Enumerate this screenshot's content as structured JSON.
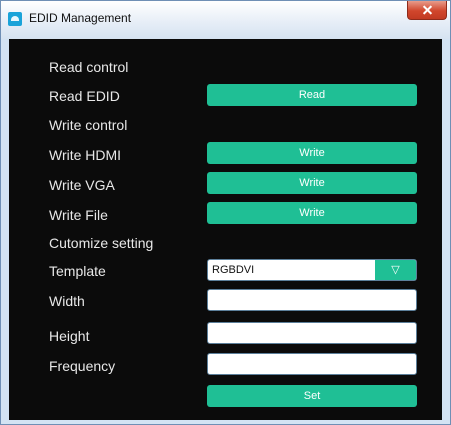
{
  "window": {
    "title": "EDID Management"
  },
  "read": {
    "section_label": "Read control",
    "edid_label": "Read EDID",
    "button_label": "Read"
  },
  "write": {
    "section_label": "Write control",
    "hdmi_label": "Write HDMI",
    "vga_label": "Write VGA",
    "file_label": "Write File",
    "button_label": "Write"
  },
  "custom": {
    "section_label": "Cutomize setting",
    "template_label": "Template",
    "template_value": "RGBDVI",
    "dropdown_glyph": "▽",
    "width_label": "Width",
    "width_value": "",
    "height_label": "Height",
    "height_value": "",
    "frequency_label": "Frequency",
    "frequency_value": "",
    "set_button": "Set"
  },
  "colors": {
    "accent": "#1fbf95",
    "panel_background": "#0b0b0b",
    "label_text": "#e8e8e8",
    "title_bar": "#dbe7f4",
    "close_button": "#c9432b"
  },
  "icons": {
    "app": "app-icon",
    "close": "close-icon",
    "dropdown": "triangle-down-icon"
  }
}
